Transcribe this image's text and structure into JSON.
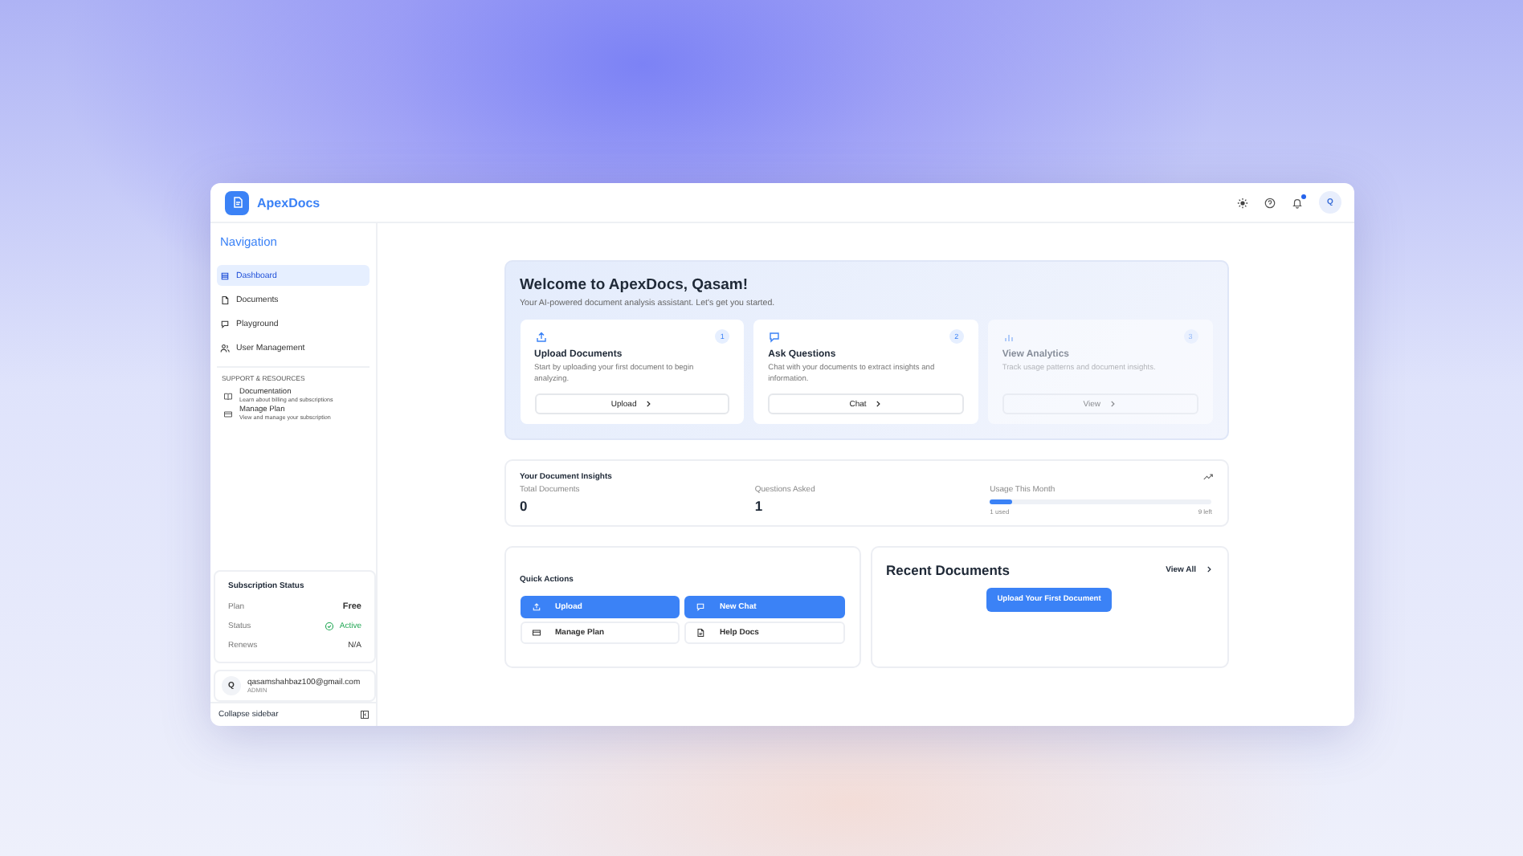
{
  "app": {
    "name": "ApexDocs"
  },
  "header": {
    "avatar": "Q",
    "notification": true
  },
  "sidebar": {
    "heading": "Navigation",
    "items": [
      {
        "label": "Dashboard",
        "selected": true
      },
      {
        "label": "Documents",
        "selected": false
      },
      {
        "label": "Playground",
        "selected": false
      },
      {
        "label": "User Management",
        "selected": false
      }
    ],
    "support_heading": "SUPPORT & RESOURCES",
    "support_items": [
      {
        "title": "Documentation",
        "subtitle": "Learn about billing and subscriptions"
      },
      {
        "title": "Manage Plan",
        "subtitle": "View and manage your subscription"
      }
    ],
    "subscription": {
      "title": "Subscription Status",
      "rows": [
        {
          "label": "Plan",
          "value": "Free",
          "kind": "text"
        },
        {
          "label": "Status",
          "value": "Active",
          "kind": "status"
        },
        {
          "label": "Renews",
          "value": "N/A",
          "kind": "text"
        }
      ]
    },
    "user": {
      "avatar": "Q",
      "email": "qasamshahbaz100@gmail.com",
      "role": "ADMIN"
    },
    "collapse": "Collapse sidebar"
  },
  "welcome": {
    "title": "Welcome to ApexDocs, Qasam!",
    "subtitle": "Your AI-powered document analysis assistant. Let's get you started.",
    "steps": [
      {
        "number": "1",
        "title": "Upload Documents",
        "text": "Start by uploading your first document to begin analyzing.",
        "button": "Upload",
        "disabled": false
      },
      {
        "number": "2",
        "title": "Ask Questions",
        "text": "Chat with your documents to extract insights and information.",
        "button": "Chat",
        "disabled": false
      },
      {
        "number": "3",
        "title": "View Analytics",
        "text": "Track usage patterns and document insights.",
        "button": "View",
        "disabled": true
      }
    ]
  },
  "insights": {
    "title": "Your Document Insights",
    "stats": [
      {
        "label": "Total Documents",
        "value": "0"
      },
      {
        "label": "Questions Asked",
        "value": "1"
      }
    ],
    "usage": {
      "label": "Usage This Month",
      "level": 0.1,
      "used": "1 used",
      "left": "9 left"
    }
  },
  "quick_actions": {
    "title": "Quick Actions",
    "buttons": [
      {
        "label": "Upload",
        "primary": true
      },
      {
        "label": "New Chat",
        "primary": true
      },
      {
        "label": "Manage Plan",
        "primary": false
      },
      {
        "label": "Help Docs",
        "primary": false
      }
    ]
  },
  "recent_documents": {
    "title": "Recent Documents",
    "view_all": "View All",
    "button": "Upload Your First Document"
  }
}
